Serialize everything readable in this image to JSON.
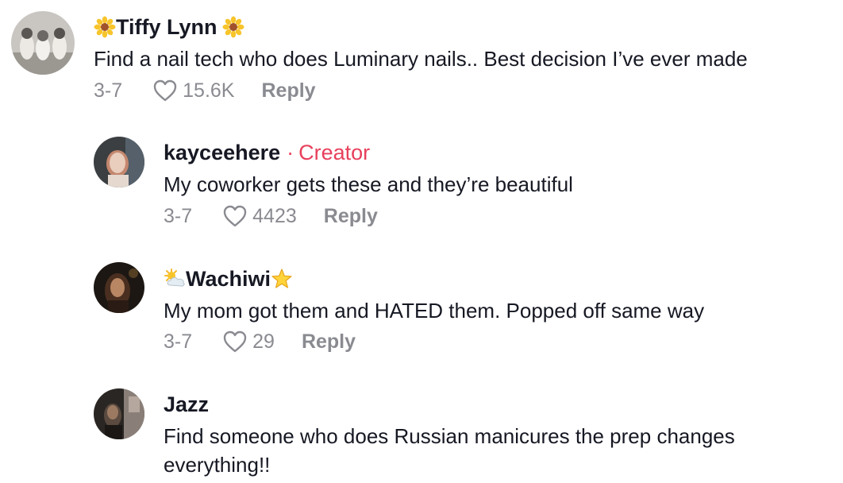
{
  "comments": [
    {
      "username": "Tiffy Lynn",
      "username_prefix_icon": "sunflower-emoji",
      "username_suffix_icon": "sunflower-emoji",
      "text": "Find a nail tech who does Luminary nails.. Best decision I’ve ever made",
      "date": "3-7",
      "likes": "15.6K",
      "reply_label": "Reply"
    },
    {
      "username": "kayceehere",
      "creator_separator": "·",
      "creator_label": "Creator",
      "text": "My coworker gets these and they’re beautiful",
      "date": "3-7",
      "likes": "4423",
      "reply_label": "Reply"
    },
    {
      "username": "Wachiwi",
      "username_prefix_icon": "sun-behind-cloud-emoji",
      "username_suffix_icon": "star-emoji",
      "text": "My mom got them and HATED them. Popped off same way",
      "date": "3-7",
      "likes": "29",
      "reply_label": "Reply"
    },
    {
      "username": "Jazz",
      "text_line1": "Find someone who does Russian manicures the prep changes",
      "text_line2": "everything!!"
    }
  ],
  "colors": {
    "creator_accent": "#E8405B",
    "meta_gray": "#8A8B91",
    "text_dark": "#161823"
  }
}
